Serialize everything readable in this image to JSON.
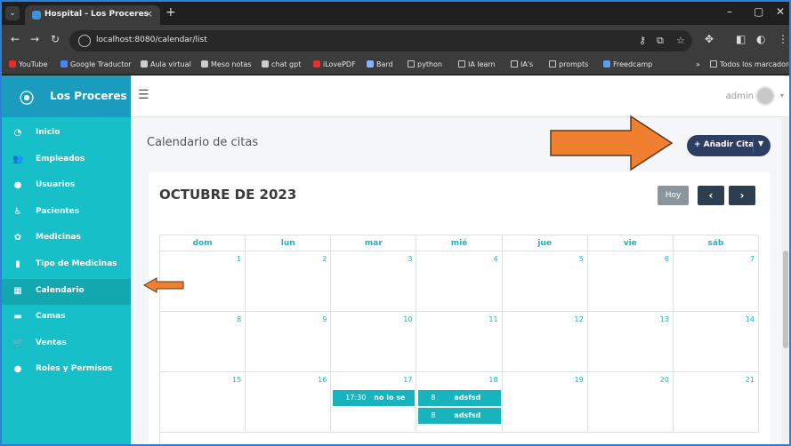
{
  "browser": {
    "tab_title": "Hospital - Los Proceres",
    "url": "localhost:8080/calendar/list",
    "bookmarks": [
      {
        "label": "YouTube",
        "color": "#e52d27"
      },
      {
        "label": "Google Traductor",
        "color": "#4285f4"
      },
      {
        "label": "Aula virtual",
        "color": "#cccccc"
      },
      {
        "label": "Meso notas",
        "color": "#cccccc"
      },
      {
        "label": "chat gpt",
        "color": "#cccccc"
      },
      {
        "label": "iLovePDF",
        "color": "#e5322d"
      },
      {
        "label": "Bard",
        "color": "#8ab4f8"
      },
      {
        "label": "python",
        "color": "folder"
      },
      {
        "label": "IA learn",
        "color": "folder"
      },
      {
        "label": "IA's",
        "color": "folder"
      },
      {
        "label": "prompts",
        "color": "folder"
      },
      {
        "label": "Freedcamp",
        "color": "#5b9df0"
      }
    ],
    "bookmarks_more": "»",
    "all_bookmarks": "Todos los marcadores"
  },
  "app": {
    "brand_name": "Los Proceres",
    "user": "admin",
    "sidebar": [
      {
        "label": "Inicio",
        "icon": "dashboard-icon",
        "glyph": "◔"
      },
      {
        "label": "Empleados",
        "icon": "users-icon",
        "glyph": "👥"
      },
      {
        "label": "Usuarios",
        "icon": "user-icon",
        "glyph": "●"
      },
      {
        "label": "Pacientes",
        "icon": "wheelchair-icon",
        "glyph": "♿"
      },
      {
        "label": "Medicinas",
        "icon": "paw-icon",
        "glyph": "✿"
      },
      {
        "label": "Tipo de Medicinas",
        "icon": "bottle-icon",
        "glyph": "▮"
      },
      {
        "label": "Calendario",
        "icon": "calendar-icon",
        "glyph": "▦",
        "active": true
      },
      {
        "label": "Camas",
        "icon": "bed-icon",
        "glyph": "▬"
      },
      {
        "label": "Ventas",
        "icon": "cart-icon",
        "glyph": "🛒"
      },
      {
        "label": "Roles y Permisos",
        "icon": "user-key-icon",
        "glyph": "●"
      }
    ],
    "page_title": "Calendario de citas",
    "add_button": "+ Añadir Cita",
    "calendar": {
      "month_title": "OCTUBRE DE 2023",
      "today_button": "Hoy",
      "prev_glyph": "‹",
      "next_glyph": "›",
      "weekdays": [
        "dom",
        "lun",
        "mar",
        "mié",
        "jue",
        "vie",
        "sáb"
      ],
      "weeks": [
        [
          "1",
          "2",
          "3",
          "4",
          "5",
          "6",
          "7"
        ],
        [
          "8",
          "9",
          "10",
          "11",
          "12",
          "13",
          "14"
        ],
        [
          "15",
          "16",
          "17",
          "18",
          "19",
          "20",
          "21"
        ]
      ],
      "events": [
        {
          "day_col": 2,
          "week": 2,
          "slot": 0,
          "time": "17:30",
          "name": "no lo se"
        },
        {
          "day_col": 3,
          "week": 2,
          "slot": 0,
          "time": "8",
          "name": "adsfsd"
        },
        {
          "day_col": 3,
          "week": 2,
          "slot": 1,
          "time": "8",
          "name": "adsfsd"
        }
      ]
    }
  },
  "colors": {
    "sidebar": "#17c0c8",
    "brand": "#1a9cbf",
    "accent": "#17b7c2",
    "primary_button": "#2c3e63",
    "annotation_arrow": "#f07f2f"
  }
}
